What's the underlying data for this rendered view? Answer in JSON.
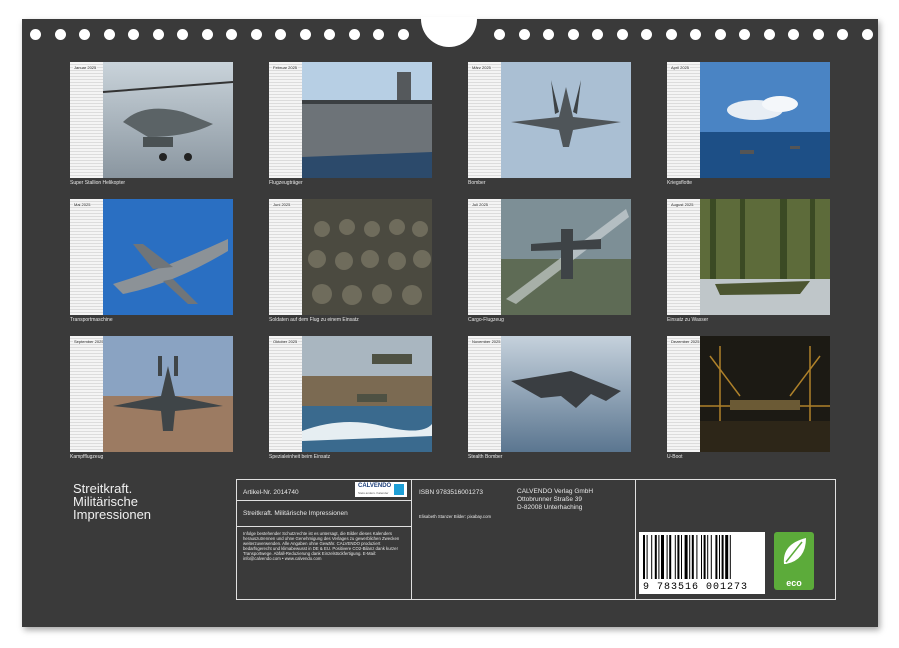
{
  "calendar": {
    "months": [
      {
        "name": "Januar 2025",
        "caption": "Super Stallion Helikopter"
      },
      {
        "name": "Februar 2025",
        "caption": "Flugzeugträger"
      },
      {
        "name": "März 2025",
        "caption": "Bomber"
      },
      {
        "name": "April 2025",
        "caption": "Kriegsflotte"
      },
      {
        "name": "Mai 2025",
        "caption": "Transportmaschine"
      },
      {
        "name": "Juni 2025",
        "caption": "Soldaten auf dem Flug zu einem Einsatz"
      },
      {
        "name": "Juli 2025",
        "caption": "Cargo-Flugzeug"
      },
      {
        "name": "August 2025",
        "caption": "Einsatz zu Wasser"
      },
      {
        "name": "September 2025",
        "caption": "Kampfflugzeug"
      },
      {
        "name": "Oktober 2025",
        "caption": "Spezialeinheit beim Einsatz"
      },
      {
        "name": "November 2025",
        "caption": "Stealth Bomber"
      },
      {
        "name": "Dezember 2025",
        "caption": "U-Boot"
      }
    ]
  },
  "title": {
    "line1": "Streitkraft.",
    "line2": "Militärische",
    "line3": "Impressionen"
  },
  "info": {
    "article": "Artikel-Nr. 2014740",
    "logo": "CALVENDO",
    "logo_sub": "Stets anders. Kalender",
    "subtitle": "Streitkraft. Militärische Impressionen",
    "legal": "Infolge bestehender Schutzrechte ist es untersagt, die Bilder dieses Kalenders herauszutrennen und ohne Genehmigung des Verlages zu gewerblichen Zwecken weiterzuverwenden. Alle Angaben ohne Gewähr. CALVENDO produziert bedarfsgerecht und klimabewusst in DE & EU. Positivere CO2-Bilanz dank kurzer Transportwege. Abfall-Reduzierung dank Einzelstückfertigung. E-Mail: info@calvendo.com • www.calvendo.com",
    "isbn": "ISBN 9783516001273",
    "credits": "Elisabeth Stanzer Bilder: pixabay.com",
    "publisher": "CALVENDO Verlag GmbH",
    "street": "Ottobrunner Straße 39",
    "city": "D-82008 Unterhaching",
    "barcode_number": "9 783516 001273",
    "eco": "eco"
  },
  "colors": {
    "background": "#3a3a3a",
    "eco_green": "#5cab3a",
    "calvendo_blue": "#1d3f7a"
  }
}
